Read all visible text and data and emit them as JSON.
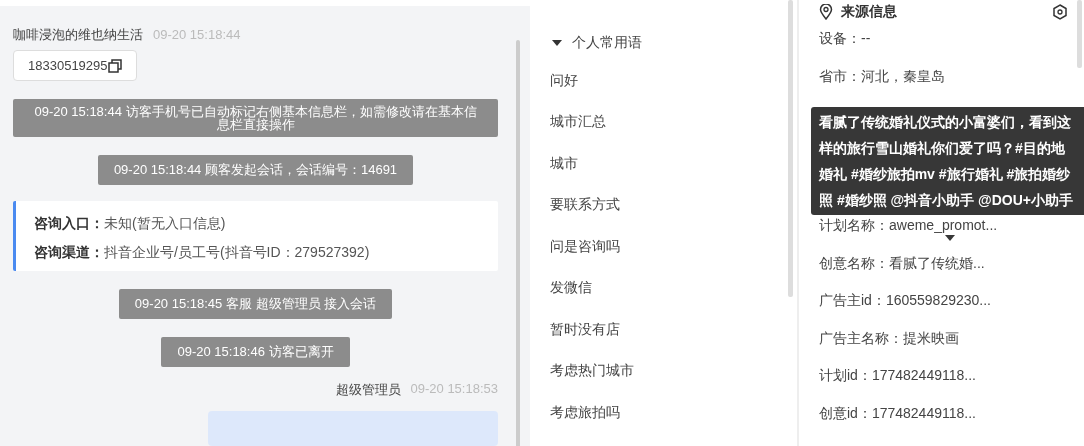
{
  "chat": {
    "sender": {
      "name": "咖啡浸泡的维也纳生活",
      "time": "09-20 15:18:44"
    },
    "phone": "18330519295",
    "notices_top": [
      "09-20 15:18:44 访客手机号已自动标记右侧基本信息栏，如需修改请在基本信息栏直接操作",
      "09-20 15:18:44 顾客发起会话，会话编号：14691"
    ],
    "info_card": [
      {
        "label": "咨询入口：",
        "value": "未知(暂无入口信息)"
      },
      {
        "label": "咨询渠道：",
        "value": "抖音企业号/员工号(抖音号ID：279527392)"
      }
    ],
    "notices_bottom": [
      "09-20 15:18:45 客服 超级管理员 接入会话",
      "09-20 15:18:46 访客已离开"
    ],
    "agent": {
      "name": "超级管理员",
      "time": "09-20 15:18:53"
    }
  },
  "phrases": {
    "group": {
      "label": "个人常用语",
      "expanded": true
    },
    "items": [
      "问好",
      "城市汇总",
      "城市",
      "要联系方式",
      "问是咨询吗",
      "发微信",
      "暂时没有店",
      "考虑热门城市",
      "考虑旅拍吗"
    ]
  },
  "source_info": {
    "title": "来源信息",
    "rows_above": [
      "设备：--",
      "省市：河北，秦皇岛"
    ],
    "rows_below": [
      "计划名称：aweme_promot...",
      "创意名称：看腻了传统婚...",
      "广告主id：160559829230...",
      "广告主名称：提米映画",
      "计划id：177482449118...",
      "创意id：177482449118..."
    ],
    "tooltip": "看腻了传统婚礼仪式的小富婆们，看到这样的旅行雪山婚礼你们爱了吗？#目的地婚礼 #婚纱旅拍mv #旅行婚礼 #旅拍婚纱照 #婚纱照 @抖音小助手 @DOU+小助手"
  }
}
